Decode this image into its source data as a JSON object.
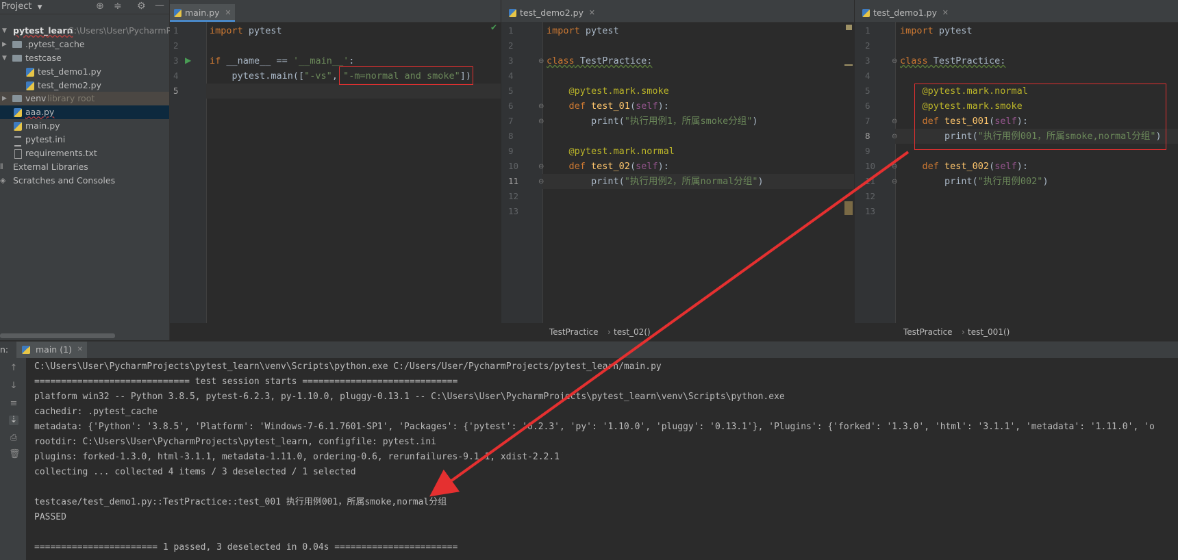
{
  "project": {
    "header_label": "Project",
    "tree": [
      {
        "label": "pytest_learn",
        "hint": "C:\\Users\\User\\PycharmPr"
      },
      {
        "label": ".pytest_cache",
        "hint": ""
      },
      {
        "label": "testcase",
        "hint": ""
      },
      {
        "label": "test_demo1.py",
        "hint": ""
      },
      {
        "label": "test_demo2.py",
        "hint": ""
      },
      {
        "label": "venv",
        "hint": "library root"
      },
      {
        "label": "aaa.py",
        "hint": ""
      },
      {
        "label": "main.py",
        "hint": ""
      },
      {
        "label": "pytest.ini",
        "hint": ""
      },
      {
        "label": "requirements.txt",
        "hint": ""
      },
      {
        "label": "External Libraries",
        "hint": ""
      },
      {
        "label": "Scratches and Consoles",
        "hint": ""
      }
    ]
  },
  "editors": [
    {
      "tab": "main.py",
      "lines": [
        "1",
        "2",
        "3",
        "4",
        "5"
      ],
      "code": {
        "l1_kw": "import",
        "l1_rest": " pytest",
        "l3_kw": "if",
        "l3_rest": " __name__ == ",
        "l3_str": "'__main__'",
        "l3_end": ":",
        "l4_pre": "    pytest.main([",
        "l4_s1": "\"-vs\"",
        "l4_comma": ", ",
        "l4_s2": "\"-m=normal and smoke\"",
        "l4_end": "])"
      }
    },
    {
      "tab": "test_demo2.py",
      "lines": [
        "1",
        "2",
        "3",
        "4",
        "5",
        "6",
        "7",
        "8",
        "9",
        "10",
        "11",
        "12",
        "13"
      ],
      "code": {
        "l1_kw": "import",
        "l1_rest": " pytest",
        "l3_kw": "class",
        "l3_name": " TestPractice:",
        "l5_dec": "    @pytest.mark.smoke",
        "l6_kw": "    def",
        "l6_fn": " test_01",
        "l6_p1": "(",
        "l6_self": "self",
        "l6_p2": "):",
        "l7_pre": "        print(",
        "l7_str": "\"执行用例1，所属smoke分组\"",
        "l7_end": ")",
        "l9_dec": "    @pytest.mark.normal",
        "l10_kw": "    def",
        "l10_fn": " test_02",
        "l10_p1": "(",
        "l10_self": "self",
        "l10_p2": "):",
        "l11_pre": "        print(",
        "l11_str": "\"执行用例2，所属normal分组\"",
        "l11_end": ")"
      },
      "breadcrumb": [
        "TestPractice",
        "test_02()"
      ]
    },
    {
      "tab": "test_demo1.py",
      "lines": [
        "1",
        "2",
        "3",
        "4",
        "5",
        "6",
        "7",
        "8",
        "9",
        "10",
        "11",
        "12",
        "13"
      ],
      "code": {
        "l1_kw": "import",
        "l1_rest": " pytest",
        "l3_kw": "class",
        "l3_name": " TestPractice:",
        "l5_dec": "    @pytest.mark.normal",
        "l6_dec": "    @pytest.mark.smoke",
        "l7_kw": "    def",
        "l7_fn": " test_001",
        "l7_p1": "(",
        "l7_self": "self",
        "l7_p2": "):",
        "l8_pre": "        print(",
        "l8_str": "\"执行用例001，所属smoke,normal分组\"",
        "l8_end": ")",
        "l10_kw": "    def",
        "l10_fn": " test_002",
        "l10_p1": "(",
        "l10_self": "self",
        "l10_p2": "):",
        "l11_pre": "        print(",
        "l11_str": "\"执行用例002\"",
        "l11_end": ")"
      },
      "breadcrumb": [
        "TestPractice",
        "test_001()"
      ]
    }
  ],
  "run": {
    "prefix": "n:",
    "tab": "main (1)",
    "console": [
      "C:\\Users\\User\\PycharmProjects\\pytest_learn\\venv\\Scripts\\python.exe C:/Users/User/PycharmProjects/pytest_learn/main.py",
      "============================= test session starts =============================",
      "platform win32 -- Python 3.8.5, pytest-6.2.3, py-1.10.0, pluggy-0.13.1 -- C:\\Users\\User\\PycharmProjects\\pytest_learn\\venv\\Scripts\\python.exe",
      "cachedir: .pytest_cache",
      "metadata: {'Python': '3.8.5', 'Platform': 'Windows-7-6.1.7601-SP1', 'Packages': {'pytest': '6.2.3', 'py': '1.10.0', 'pluggy': '0.13.1'}, 'Plugins': {'forked': '1.3.0', 'html': '3.1.1', 'metadata': '1.11.0', 'o",
      "rootdir: C:\\Users\\User\\PycharmProjects\\pytest_learn, configfile: pytest.ini",
      "plugins: forked-1.3.0, html-3.1.1, metadata-1.11.0, ordering-0.6, rerunfailures-9.1.1, xdist-2.2.1",
      "collecting ... collected 4 items / 3 deselected / 1 selected",
      "",
      "testcase/test_demo1.py::TestPractice::test_001 执行用例001，所属smoke,normal分组",
      "PASSED",
      "",
      "======================= 1 passed, 3 deselected in 0.04s ======================="
    ]
  },
  "colors": {
    "annotation": "#e53030",
    "accent": "#4a88c7"
  }
}
